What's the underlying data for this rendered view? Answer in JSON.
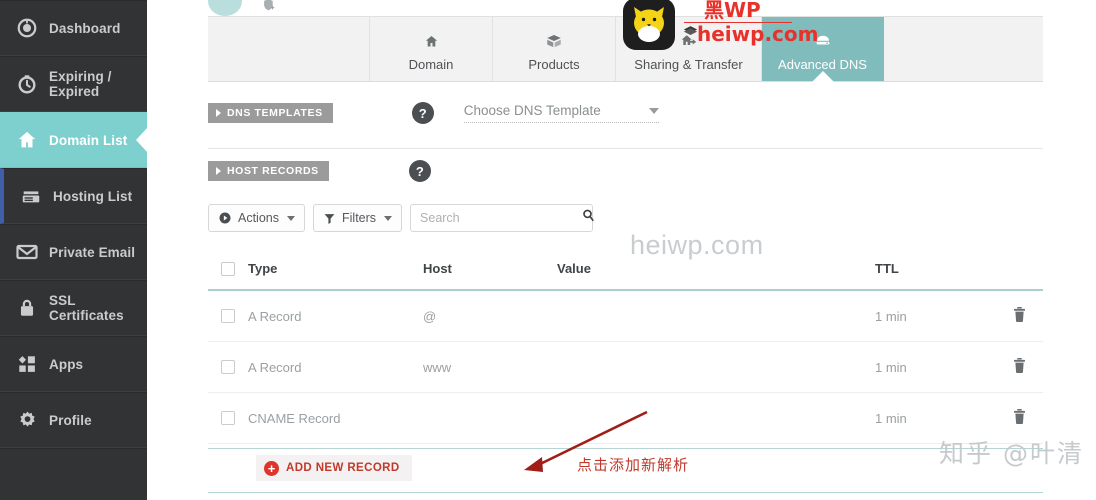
{
  "sidebar": {
    "items": [
      {
        "label": "Dashboard",
        "icon": "dashboard-icon",
        "active": false
      },
      {
        "label": "Expiring / Expired",
        "icon": "clock-icon",
        "active": false
      },
      {
        "label": "Domain List",
        "icon": "home-icon",
        "active": true
      },
      {
        "label": "Hosting List",
        "icon": "server-icon",
        "active": false
      },
      {
        "label": "Private Email",
        "icon": "envelope-icon",
        "active": false
      },
      {
        "label": "SSL Certificates",
        "icon": "lock-icon",
        "active": false
      },
      {
        "label": "Apps",
        "icon": "apps-icon",
        "active": false
      },
      {
        "label": "Profile",
        "icon": "gear-icon",
        "active": false
      }
    ]
  },
  "tabs": [
    {
      "label": "Domain",
      "icon": "home-icon",
      "active": false
    },
    {
      "label": "Products",
      "icon": "box-icon",
      "active": false
    },
    {
      "label": "Sharing & Transfer",
      "icon": "transfer-icon",
      "active": false
    },
    {
      "label": "Advanced DNS",
      "icon": "dns-icon",
      "active": true
    }
  ],
  "sections": {
    "dns_templates": {
      "pill": "DNS TEMPLATES",
      "help": "?",
      "select_value": "Choose DNS Template"
    },
    "host_records": {
      "pill": "HOST RECORDS",
      "help": "?"
    }
  },
  "toolbar": {
    "actions_label": "Actions",
    "filters_label": "Filters",
    "search_placeholder": "Search",
    "search_value": ""
  },
  "table": {
    "columns": [
      "Type",
      "Host",
      "Value",
      "TTL"
    ],
    "rows": [
      {
        "type": "A Record",
        "host": "@",
        "value": "",
        "ttl": "1 min"
      },
      {
        "type": "A Record",
        "host": "www",
        "value": "",
        "ttl": "1 min"
      },
      {
        "type": "CNAME Record",
        "host": "",
        "value": "",
        "ttl": "1 min"
      }
    ]
  },
  "add_record": {
    "label": "ADD NEW RECORD",
    "plus": "+"
  },
  "annotation": {
    "text": "点击添加新解析",
    "color": "#c0392b"
  },
  "watermarks": {
    "center": "heiwp.com",
    "zhihu": "知乎 @叶清",
    "brand_line1": "黑WP",
    "brand_line2": "heiwp.com"
  },
  "colors": {
    "sidebar_bg": "#313335",
    "sidebar_active": "#7ed0ce",
    "tab_active": "#7fbcbb",
    "accent_red": "#c0392b",
    "header_rule": "#a9cfce"
  }
}
